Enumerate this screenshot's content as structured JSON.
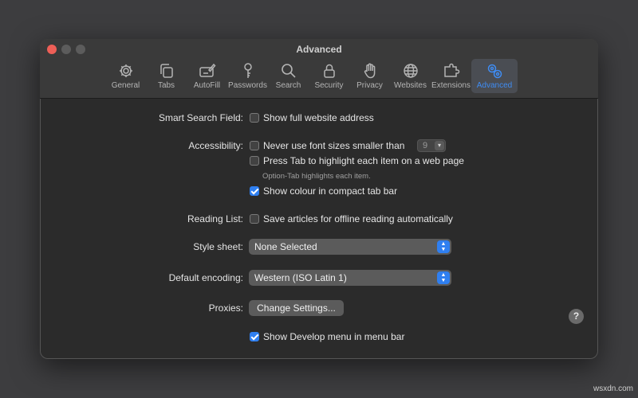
{
  "window": {
    "title": "Advanced"
  },
  "toolbar": {
    "tabs": [
      {
        "label": "General",
        "icon": "gear-icon"
      },
      {
        "label": "Tabs",
        "icon": "tabs-icon"
      },
      {
        "label": "AutoFill",
        "icon": "autofill-icon"
      },
      {
        "label": "Passwords",
        "icon": "key-icon"
      },
      {
        "label": "Search",
        "icon": "magnifier-icon"
      },
      {
        "label": "Security",
        "icon": "lock-icon"
      },
      {
        "label": "Privacy",
        "icon": "hand-icon"
      },
      {
        "label": "Websites",
        "icon": "globe-icon"
      },
      {
        "label": "Extensions",
        "icon": "puzzle-icon"
      },
      {
        "label": "Advanced",
        "icon": "gears-icon",
        "active": true
      }
    ]
  },
  "settings": {
    "smart_search": {
      "label": "Smart Search Field:",
      "option": "Show full website address",
      "checked": false
    },
    "accessibility": {
      "label": "Accessibility:",
      "min_font": {
        "option": "Never use font sizes smaller than",
        "checked": false,
        "value": "9"
      },
      "press_tab": {
        "option": "Press Tab to highlight each item on a web page",
        "checked": false
      },
      "hint": "Option-Tab highlights each item.",
      "compact_tab": {
        "option": "Show colour in compact tab bar",
        "checked": true
      }
    },
    "reading_list": {
      "label": "Reading List:",
      "option": "Save articles for offline reading automatically",
      "checked": false
    },
    "style_sheet": {
      "label": "Style sheet:",
      "value": "None Selected"
    },
    "encoding": {
      "label": "Default encoding:",
      "value": "Western (ISO Latin 1)"
    },
    "proxies": {
      "label": "Proxies:",
      "button": "Change Settings..."
    },
    "develop_menu": {
      "option": "Show Develop menu in menu bar",
      "checked": true
    }
  },
  "help": {
    "label": "?"
  },
  "watermark": "wsxdn.com",
  "colors": {
    "accent": "#2f7ff0",
    "active_tab_text": "#3f8cf2",
    "window_bg": "#2b2b2b"
  }
}
